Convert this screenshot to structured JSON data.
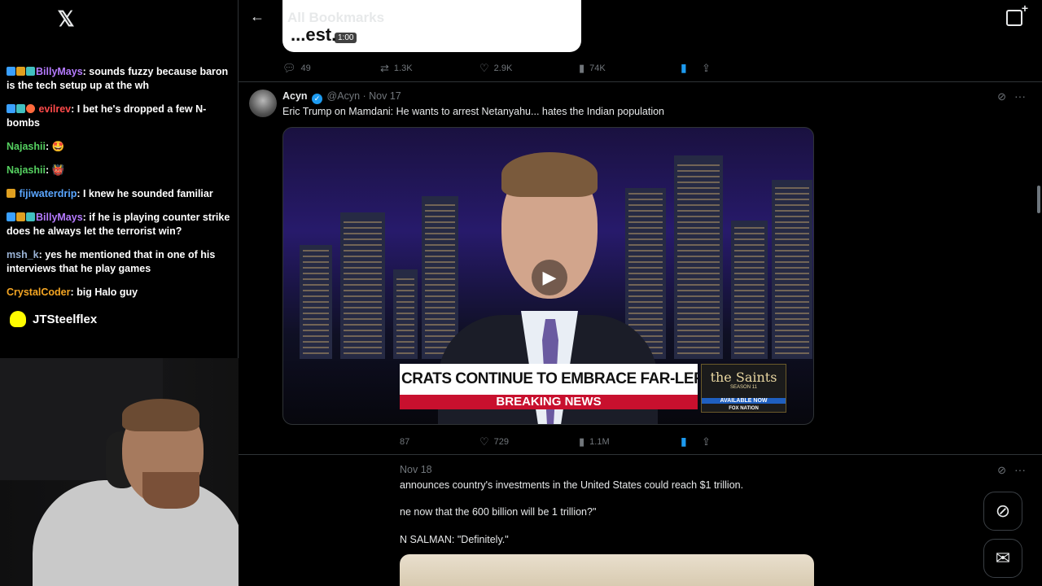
{
  "chat": {
    "messages": [
      {
        "user": "BillyMays",
        "text": ": sounds fuzzy because baron is the tech setup up at the wh"
      },
      {
        "user": "evilrev",
        "text": ": I bet he's dropped a few N-bombs"
      },
      {
        "user": "Najashii",
        "text": ": 🤩"
      },
      {
        "user": "Najashii",
        "text": ": 👹"
      },
      {
        "user": "fijiwaterdrip",
        "text": ": I knew he sounded familiar"
      },
      {
        "user": "BillyMays",
        "text": ": if he is playing counter strike does he always let the terrorist win?"
      },
      {
        "user": "msh_k",
        "text": ": yes he mentioned that in one of his interviews that he play games"
      },
      {
        "user": "CrystalCoder",
        "text": ": big Halo guy"
      }
    ],
    "snap_name": "JTSteelflex"
  },
  "header": {
    "title": "All Bookmarks",
    "back_glyph": "←"
  },
  "prev_tweet": {
    "media_text": "...est.",
    "duration": "1:00",
    "replies": "49",
    "reposts": "1.3K",
    "likes": "2.9K",
    "views": "74K"
  },
  "tweet1": {
    "name": "Acyn",
    "handle": "@Acyn",
    "date": "· Nov 17",
    "text": "Eric Trump on Mamdani: He wants to arrest Netanyahu... hates the Indian population",
    "chyron_top": "CRATS CONTINUE TO EMBRACE FAR-LEFT IDEOLOGY",
    "chyron_bottom": "BREAKING NEWS",
    "promo_title": "the Saints",
    "promo_season": "SEASON 11",
    "promo_available": "AVAILABLE NOW",
    "promo_network": "FOX NATION",
    "reposts": "87",
    "likes": "729",
    "views": "1.1M"
  },
  "tweet2": {
    "date": "Nov 18",
    "line1": "announces country's investments in the United States could reach $1 trillion.",
    "line2": "ne now that the 600 billion will be 1 trillion?\"",
    "line3": "N SALMAN: \"Definitely.\""
  },
  "icons": {
    "x_logo": "x-logo-icon",
    "grok": "grok-icon",
    "messages": "envelope-icon"
  },
  "colors": {
    "accent": "#1d9bf0",
    "bg": "#000000",
    "muted": "#71767b"
  }
}
